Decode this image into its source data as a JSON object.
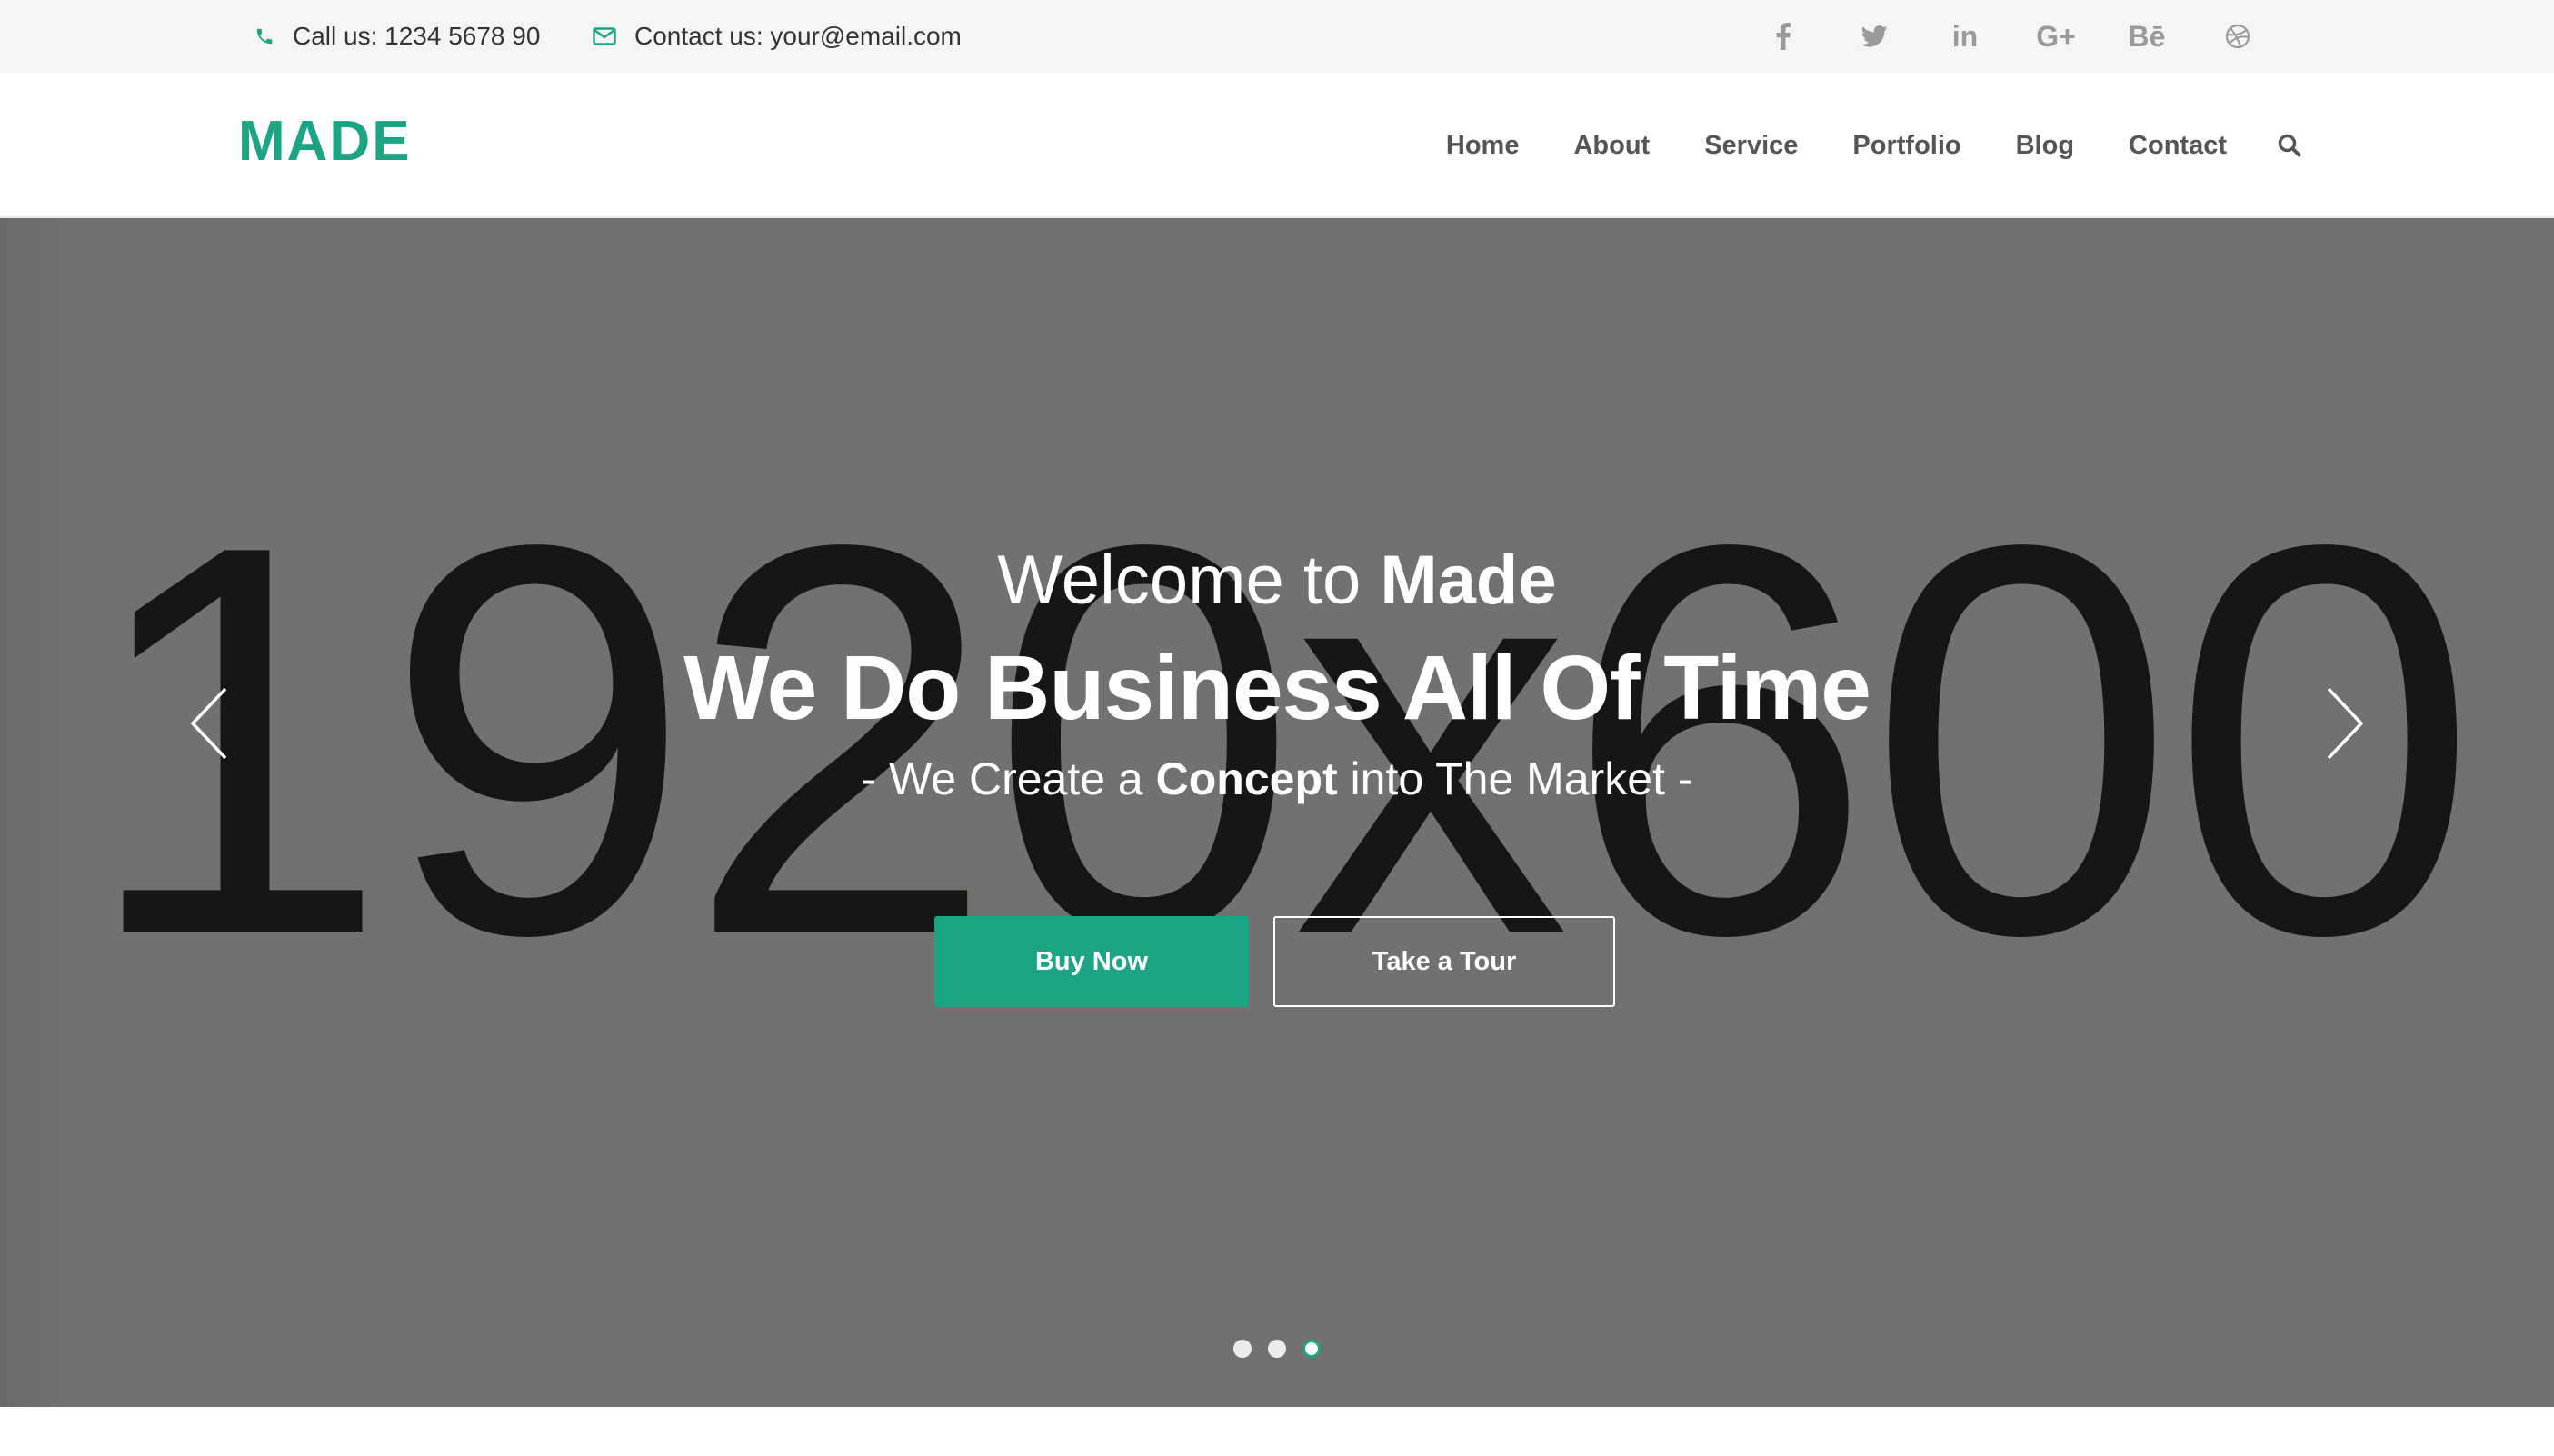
{
  "topbar": {
    "phone_text": "Call us: 1234 5678 90",
    "email_text": "Contact us: your@email.com",
    "socials": [
      {
        "name": "facebook-icon",
        "glyph": "f"
      },
      {
        "name": "twitter-icon",
        "glyph": ""
      },
      {
        "name": "linkedin-icon",
        "glyph": "in"
      },
      {
        "name": "google-plus-icon",
        "glyph": "G+"
      },
      {
        "name": "behance-icon",
        "glyph": "Bē"
      },
      {
        "name": "dribbble-icon",
        "glyph": ""
      }
    ]
  },
  "header": {
    "logo": "MADE",
    "nav": [
      "Home",
      "About",
      "Service",
      "Portfolio",
      "Blog",
      "Contact"
    ]
  },
  "hero": {
    "placeholder": "1920x600",
    "welcome_prefix": "Welcome to ",
    "welcome_brand": "Made",
    "headline": "We Do Business All Of Time",
    "tagline_prefix": "- We Create a ",
    "tagline_bold": "Concept",
    "tagline_suffix": " into The Market -",
    "buy_button": "Buy Now",
    "tour_button": "Take a Tour",
    "slides_total": 3,
    "active_slide": 3
  },
  "colors": {
    "accent": "#1ba584",
    "hero_bg": "#72716f",
    "topbar_bg": "#f5f5f5"
  }
}
